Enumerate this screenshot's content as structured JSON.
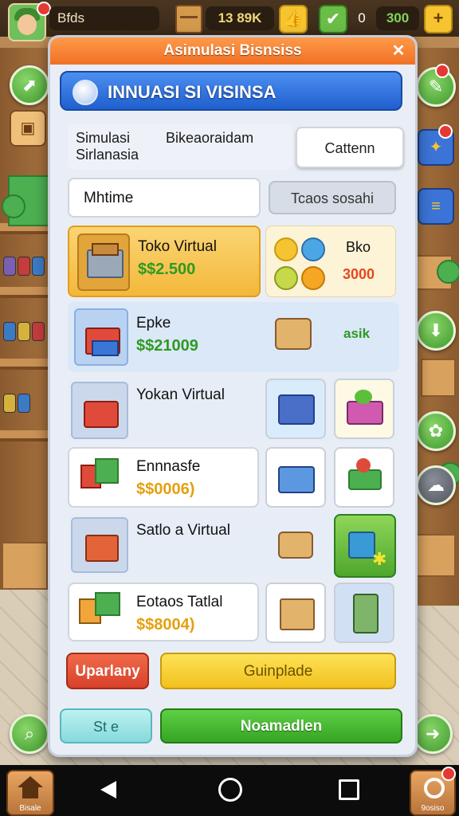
{
  "hud": {
    "player_name": "Bfds",
    "coins": "13 89K",
    "zero_count": "0",
    "gems": "300",
    "plus_label": "+"
  },
  "modal": {
    "title": "Asimulasi Bisnsiss",
    "close_label": "✕",
    "banner": "INNUASI SI VISINSA",
    "info_left": "Simulasi\nSirlanasia",
    "info_right": "Bikeaoraidam",
    "cattenn_button": "Cattenn",
    "name_field": "Mhtime",
    "teaos_button": "Tcaos sosahi"
  },
  "items": [
    {
      "title": "Toko Virtual",
      "price": "$$2.500",
      "side_label": "Bko",
      "side_value": "3000"
    },
    {
      "title": "Epke",
      "price": "$$21009",
      "side_value": "asik"
    },
    {
      "title": "Yokan Virtual"
    },
    {
      "title": "Ennnasfe",
      "price": "$$0006)"
    },
    {
      "title": "Satlo a Virtual"
    },
    {
      "title": "Eotaos Tatlal",
      "price": "$$8004)"
    }
  ],
  "actions": {
    "upgrade": "Uparlany",
    "yellow": "Guinplade",
    "cyan": "St  e",
    "green": "Noamadlen"
  },
  "nav": {
    "home_label": "Bisale",
    "profile_label": "9osiso"
  },
  "colors": {
    "title_orange": "#f07024",
    "banner_blue": "#1f5fce",
    "price_green": "#2e9a22",
    "highlight_yellow": "#f6c445",
    "button_green": "#35a424"
  }
}
